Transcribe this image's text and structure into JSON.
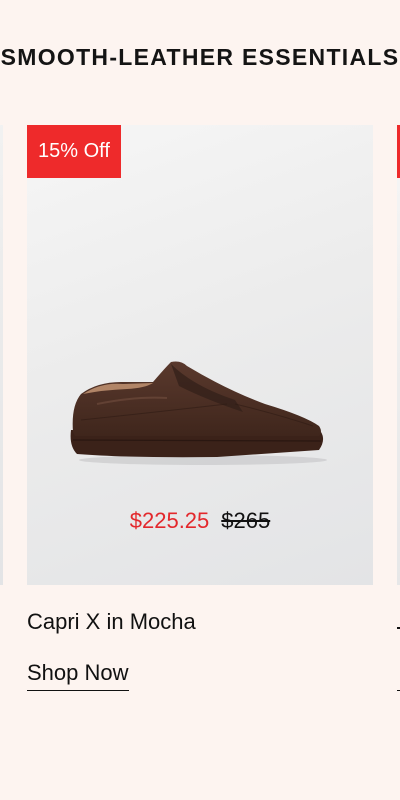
{
  "section": {
    "title": "SMOOTH-LEATHER ESSENTIALS"
  },
  "colors": {
    "background": "#fdf4f0",
    "badge": "#ee2a2b",
    "sale_price": "#e3282c",
    "shoe": "#4a2d22"
  },
  "products": [
    {
      "badge": "15% Off",
      "image_icon": "mocha-leather-sneaker",
      "sale_price": "$225.25",
      "original_price": "$265",
      "name": "Capri X in Mocha",
      "cta": "Shop Now"
    }
  ]
}
